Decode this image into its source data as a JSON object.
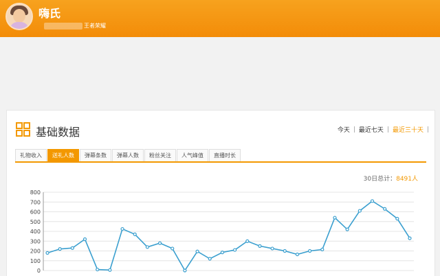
{
  "header": {
    "user_name": "嗨氏",
    "game_tag": "王者荣耀"
  },
  "panel": {
    "title": "基础数据",
    "ranges": [
      "今天",
      "最近七天",
      "最近三十天"
    ],
    "active_range": 2,
    "tabs": [
      "礼物收入",
      "送礼人数",
      "弹幕条数",
      "弹幕人数",
      "粉丝关注",
      "人气峰值",
      "直播时长"
    ],
    "active_tab": 1,
    "total_label": "30日总计：",
    "total_value": "8491人"
  },
  "colors": {
    "accent": "#f39800",
    "line": "#3a9fcf"
  },
  "chart_data": {
    "type": "line",
    "ylim": [
      0,
      800
    ],
    "yticks": [
      0,
      100,
      200,
      300,
      400,
      500,
      600,
      700,
      800
    ],
    "grid": true,
    "series": [
      {
        "values": [
          180,
          220,
          230,
          320,
          10,
          5,
          425,
          370,
          240,
          280,
          225,
          0,
          195,
          120,
          185,
          210,
          300,
          250,
          225,
          200,
          165,
          200,
          215,
          540,
          420,
          610,
          710,
          630,
          530,
          330
        ]
      }
    ]
  }
}
